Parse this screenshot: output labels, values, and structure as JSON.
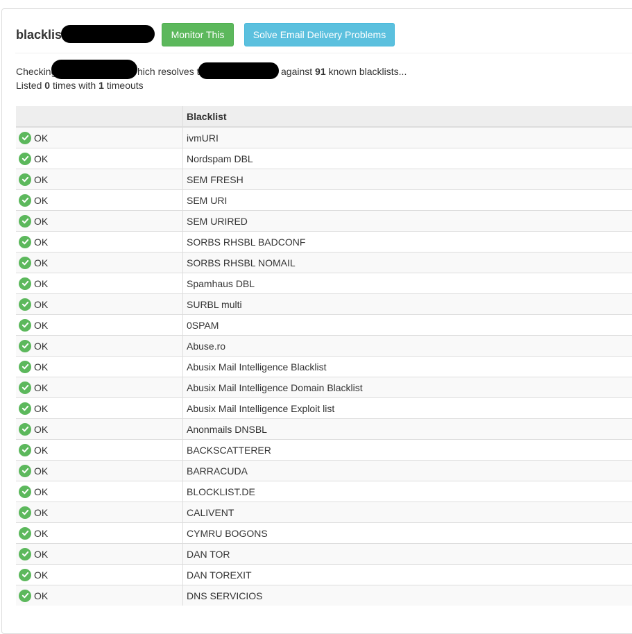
{
  "header": {
    "title": "blacklist",
    "monitor_button": "Monitor This",
    "solve_button": "Solve Email Delivery Problems"
  },
  "summary": {
    "checking_prefix": "Checking",
    "which_resolves_fragment": "hich resolves t",
    "against_prefix": "against",
    "known_count": "91",
    "known_suffix": "known blacklists...",
    "listed_prefix": "Listed",
    "listed_count": "0",
    "times_with": "times with",
    "timeout_count": "1",
    "timeouts_suffix": "timeouts"
  },
  "table": {
    "columns": [
      "",
      "Blacklist"
    ],
    "rows": [
      {
        "status": "OK",
        "blacklist": "ivmURI"
      },
      {
        "status": "OK",
        "blacklist": "Nordspam DBL"
      },
      {
        "status": "OK",
        "blacklist": "SEM FRESH"
      },
      {
        "status": "OK",
        "blacklist": "SEM URI"
      },
      {
        "status": "OK",
        "blacklist": "SEM URIRED"
      },
      {
        "status": "OK",
        "blacklist": "SORBS RHSBL BADCONF"
      },
      {
        "status": "OK",
        "blacklist": "SORBS RHSBL NOMAIL"
      },
      {
        "status": "OK",
        "blacklist": "Spamhaus DBL"
      },
      {
        "status": "OK",
        "blacklist": "SURBL multi"
      },
      {
        "status": "OK",
        "blacklist": "0SPAM"
      },
      {
        "status": "OK",
        "blacklist": "Abuse.ro"
      },
      {
        "status": "OK",
        "blacklist": "Abusix Mail Intelligence Blacklist"
      },
      {
        "status": "OK",
        "blacklist": "Abusix Mail Intelligence Domain Blacklist"
      },
      {
        "status": "OK",
        "blacklist": "Abusix Mail Intelligence Exploit list"
      },
      {
        "status": "OK",
        "blacklist": "Anonmails DNSBL"
      },
      {
        "status": "OK",
        "blacklist": "BACKSCATTERER"
      },
      {
        "status": "OK",
        "blacklist": "BARRACUDA"
      },
      {
        "status": "OK",
        "blacklist": "BLOCKLIST.DE"
      },
      {
        "status": "OK",
        "blacklist": "CALIVENT"
      },
      {
        "status": "OK",
        "blacklist": "CYMRU BOGONS"
      },
      {
        "status": "OK",
        "blacklist": "DAN TOR"
      },
      {
        "status": "OK",
        "blacklist": "DAN TOREXIT"
      },
      {
        "status": "OK",
        "blacklist": "DNS SERVICIOS"
      }
    ]
  },
  "icons": {
    "status_ok": "check-circle-icon"
  },
  "colors": {
    "ok_green": "#5cb85c",
    "monitor_green": "#5cb85c",
    "solve_blue": "#5bc0de"
  }
}
